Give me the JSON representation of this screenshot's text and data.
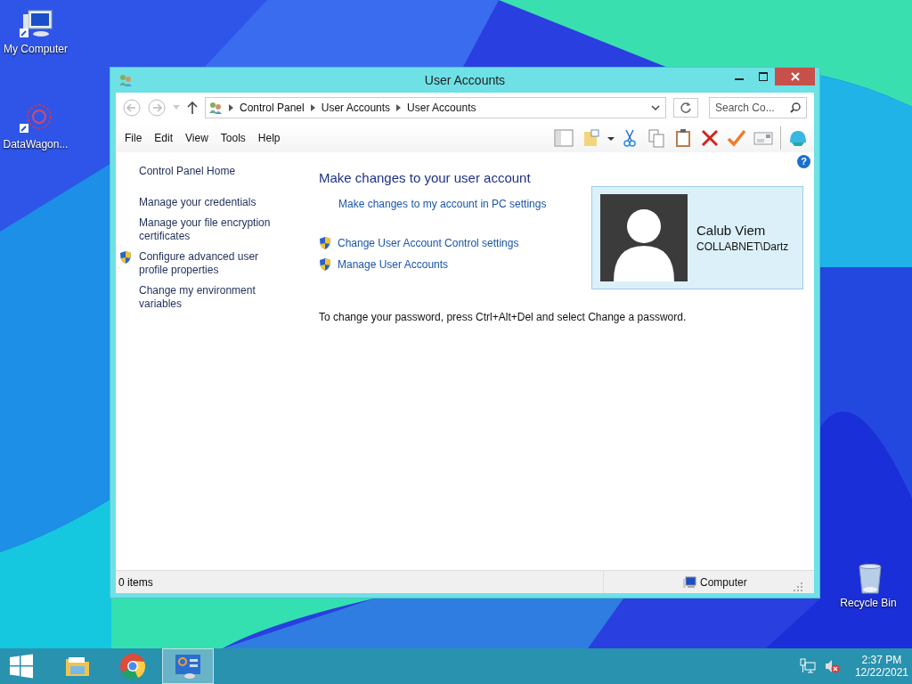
{
  "desktop_icons": [
    {
      "kind": "computer",
      "label": "My Computer"
    },
    {
      "kind": "app",
      "label": "DataWagon..."
    },
    {
      "kind": "bin",
      "label": "Recycle Bin"
    }
  ],
  "window": {
    "title": "User Accounts",
    "breadcrumb": [
      "Control Panel",
      "User Accounts",
      "User Accounts"
    ],
    "search": {
      "placeholder": "Search Co..."
    },
    "menu": [
      "File",
      "Edit",
      "View",
      "Tools",
      "Help"
    ],
    "sidebar": {
      "items": [
        {
          "label": "Control Panel Home",
          "shield": false,
          "kind": "home"
        },
        {
          "label": "Manage your credentials",
          "shield": false,
          "kind": "link"
        },
        {
          "label": "Manage your file encryption certificates",
          "shield": false,
          "kind": "link"
        },
        {
          "label": "Configure advanced user profile properties",
          "shield": true,
          "kind": "link"
        },
        {
          "label": "Change my environment variables",
          "shield": false,
          "kind": "link"
        }
      ]
    },
    "help": "?",
    "main": {
      "heading": "Make changes to your user account",
      "links": [
        {
          "label": "Make changes to my account in PC settings",
          "shield": false
        },
        {
          "label": "Change User Account Control settings",
          "shield": true
        },
        {
          "label": "Manage User Accounts",
          "shield": true
        }
      ],
      "account": {
        "name": "Calub Viem",
        "domain": "COLLABNET\\Dartz"
      },
      "note": "To change your password, press Ctrl+Alt+Del and select Change a password."
    },
    "status_bar": {
      "items": "0 items",
      "location": "Computer"
    }
  },
  "taskbar": {
    "apps": [
      {
        "kind": "explorer",
        "selected": false
      },
      {
        "kind": "chrome",
        "selected": false
      },
      {
        "kind": "control-panel",
        "selected": true
      }
    ],
    "time": "2:37 PM",
    "date": "12/22/2021"
  }
}
